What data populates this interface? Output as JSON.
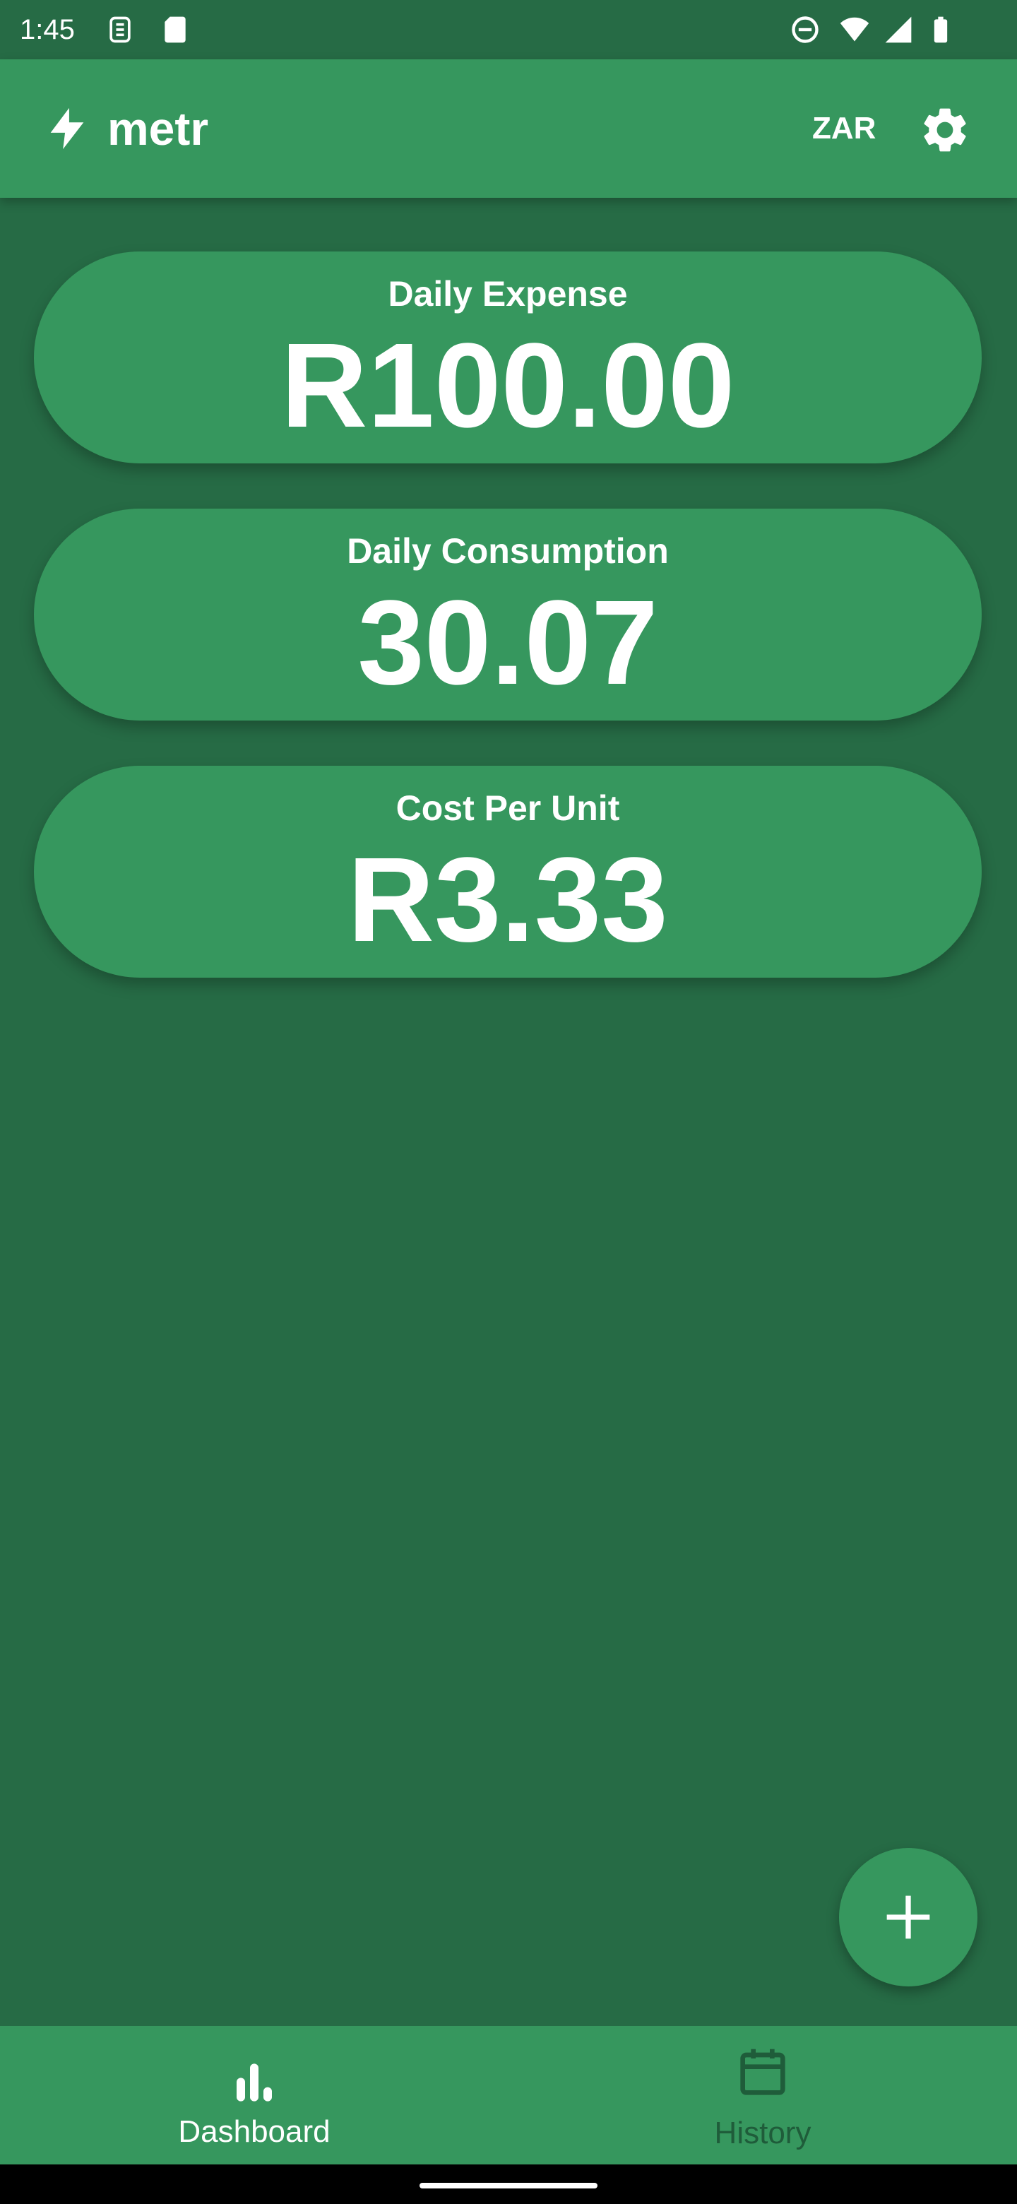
{
  "status_bar": {
    "time": "1:45",
    "icons": [
      "sim-icon",
      "sd-card-icon",
      "dnd-icon",
      "wifi-icon",
      "signal-icon",
      "battery-icon"
    ]
  },
  "app_bar": {
    "title": "metr",
    "logo_icon": "bolt-icon",
    "currency": "ZAR",
    "settings_icon": "gear-icon"
  },
  "cards": [
    {
      "label": "Daily Expense",
      "value": "R100.00"
    },
    {
      "label": "Daily Consumption",
      "value": "30.07"
    },
    {
      "label": "Cost Per Unit",
      "value": "R3.33"
    }
  ],
  "fab": {
    "icon": "plus-icon"
  },
  "bottom_nav": {
    "items": [
      {
        "label": "Dashboard",
        "icon": "bar-chart-icon",
        "active": true
      },
      {
        "label": "History",
        "icon": "calendar-icon",
        "active": false
      }
    ]
  },
  "colors": {
    "background": "#266B45",
    "surface": "#36975E",
    "inactive_nav": "#1F5C3A",
    "text": "#FFFFFF"
  }
}
